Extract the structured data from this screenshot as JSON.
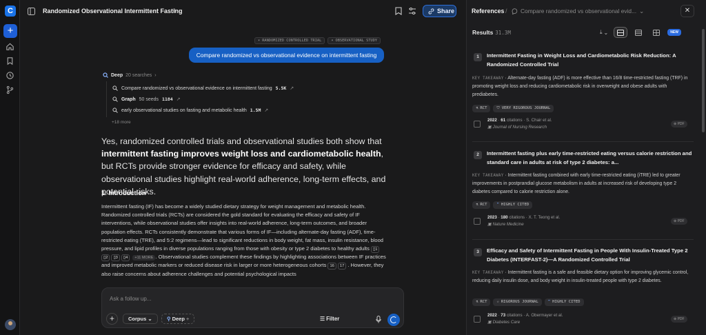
{
  "app": {
    "logo": "C",
    "new_button": "+"
  },
  "header": {
    "title": "Randomized Observational Intermittent Fasting",
    "count": "1",
    "share_label": "Share"
  },
  "chat": {
    "tags": [
      "RANDOMIZED CONTROLLED TRIAL",
      "OBSERVATIONAL STUDY"
    ],
    "user_message": "Compare randomized vs observational evidence on intermittent fasting",
    "deep": {
      "label": "Deep",
      "searches": "20 searches",
      "more": "+18 more"
    },
    "searches": [
      {
        "text": "Compare randomized vs observational evidence on intermittent fasting",
        "count": "5.5K",
        "icon": "search-icon"
      },
      {
        "text": "Graph",
        "extra": "50 seeds",
        "count": "1184",
        "icon": "graph-icon"
      },
      {
        "text": "early observational studies on fasting and metabolic health",
        "count": "1.5M",
        "icon": "search-icon"
      }
    ],
    "lead": {
      "p1": "Yes, randomized controlled trials and observational studies both show that ",
      "bold": "intermittent fasting improves weight loss and cardiometabolic health",
      "p2": ", but RCTs provide stronger evidence for efficacy and safety, while observational studies highlight real-world adherence, long-term effects, and potential risks."
    },
    "section_title": "1. Introduction",
    "body": {
      "t1": "Intermittent fasting (IF) has become a widely studied dietary strategy for weight management and metabolic health. Randomized controlled trials (RCTs) are considered the gold standard for evaluating the efficacy and safety of IF interventions, while observational studies offer insights into real-world adherence, long-term outcomes, and broader population effects. RCTs consistently demonstrate that various forms of IF—including alternate-day fasting (ADF), time-restricted eating (TRE), and 5:2 regimens—lead to significant reductions in body weight, fat mass, insulin resistance, blood pressure, and lipid profiles in diverse populations ranging from those with obesity or type 2 diabetes to healthy adults ",
      "cites1": [
        "1",
        "2",
        "3",
        "4"
      ],
      "more_cites": "+11 MORE",
      "t2": ". Observational studies complement these findings by highlighting associations between IF practices and improved metabolic markers or reduced disease risk in larger or more heterogeneous cohorts ",
      "cites2": [
        "16",
        "17"
      ],
      "t3": ". However, they also raise concerns about adherence challenges and potential psychological impacts"
    },
    "composer": {
      "placeholder": "Ask a follow up...",
      "plus": "+",
      "corpus_label": "Corpus",
      "deep_label": "Deep",
      "filter_label": "Filter"
    }
  },
  "references": {
    "title": "References",
    "breadcrumb": "Compare randomized vs observational evid...",
    "results_label": "Results",
    "results_count": "31.3M",
    "new_badge": "NEW",
    "kt_label": "KEY TAKEAWAY",
    "pdf_label": "PDF",
    "cards": [
      {
        "num": "1",
        "title": "Intermittent Fasting in Weight Loss and Cardiometabolic Risk Reduction: A Randomized Controlled Trial",
        "takeaway": "Alternate-day fasting (ADF) is more effective than 16/8 time-restricted fasting (TRF) in promoting weight loss and reducing cardiometabolic risk in overweight and obese adults with prediabetes.",
        "badges": [
          "RCT",
          "VERY RIGOROUS JOURNAL"
        ],
        "year": "2022",
        "citations": "61",
        "citations_label": "citations",
        "authors": "S. Chair et al.",
        "journal": "Journal of Nursing Research"
      },
      {
        "num": "2",
        "title": "Intermittent fasting plus early time-restricted eating versus calorie restriction and standard care in adults at risk of type 2 diabetes: a...",
        "takeaway": "Intermittent fasting combined with early time-restricted eating (iTRE) led to greater improvements in postprandial glucose metabolism in adults at increased risk of developing type 2 diabetes compared to calorie restriction alone.",
        "badges": [
          "RCT",
          "HIGHLY CITED"
        ],
        "year": "2023",
        "citations": "180",
        "citations_label": "citations",
        "authors": "X. T. Teong et al.",
        "journal": "Nature Medicine"
      },
      {
        "num": "3",
        "title": "Efficacy and Safety of Intermittent Fasting in People With Insulin-Treated Type 2 Diabetes (INTERFAST-2)—A Randomized Controlled Trial",
        "takeaway": "Intermittent fasting is a safe and feasible dietary option for improving glycemic control, reducing daily insulin dose, and body weight in insulin-treated people with type 2 diabetes.",
        "badges": [
          "RCT",
          "RIGOROUS JOURNAL",
          "HIGHLY CITED"
        ],
        "year": "2022",
        "citations": "73",
        "citations_label": "citations",
        "authors": "A. Obermayer et al.",
        "journal": "Diabetes Care"
      }
    ]
  },
  "colors": {
    "accent": "#1760c4",
    "background": "#1a1a1b",
    "panel": "#1d1d1f"
  }
}
